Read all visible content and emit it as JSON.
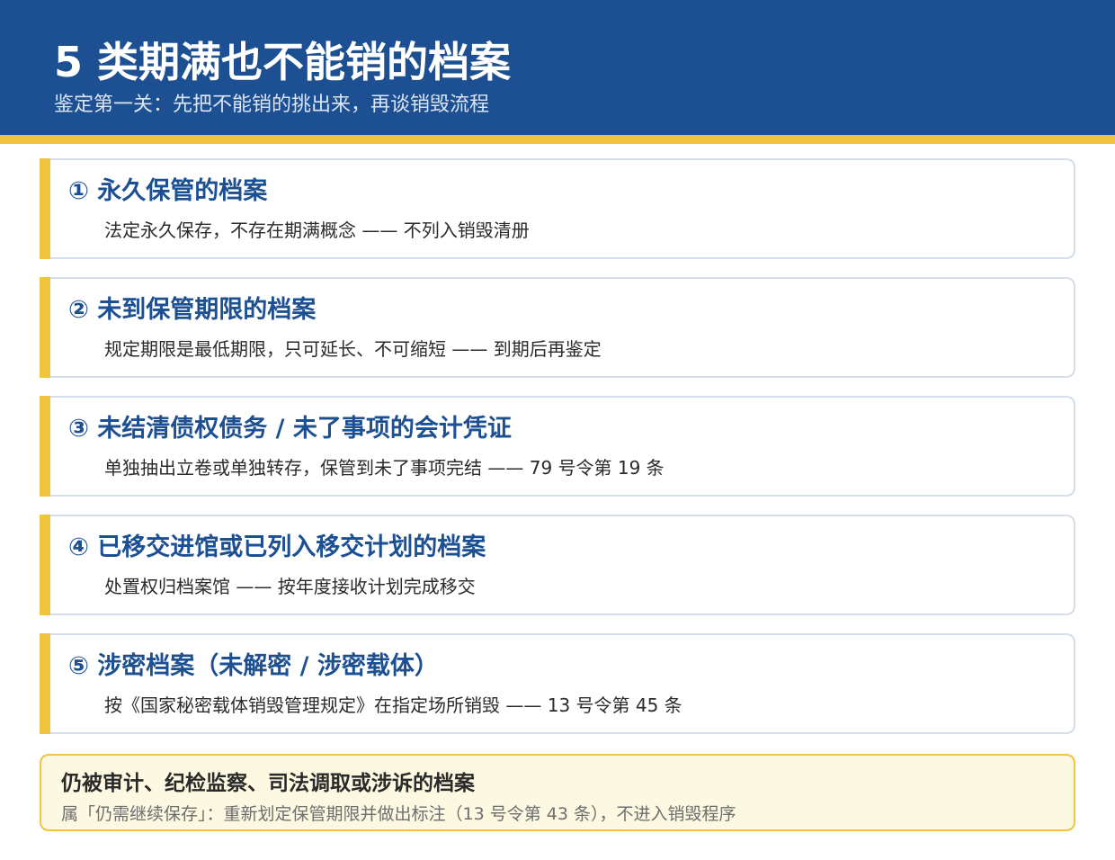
{
  "header": {
    "title": "5 类期满也不能销的档案",
    "subtitle": "鉴定第一关：先把不能销的挑出来，再谈销毁流程"
  },
  "items": [
    {
      "title": "① 永久保管的档案",
      "desc": "法定永久保存，不存在期满概念 —— 不列入销毁清册"
    },
    {
      "title": "② 未到保管期限的档案",
      "desc": "规定期限是最低期限，只可延长、不可缩短 —— 到期后再鉴定"
    },
    {
      "title": "③ 未结清债权债务 / 未了事项的会计凭证",
      "desc": "单独抽出立卷或单独转存，保管到未了事项完结 —— 79 号令第 19 条"
    },
    {
      "title": "④ 已移交进馆或已列入移交计划的档案",
      "desc": "处置权归档案馆 —— 按年度接收计划完成移交"
    },
    {
      "title": "⑤ 涉密档案（未解密 / 涉密载体）",
      "desc": "按《国家秘密载体销毁管理规定》在指定场所销毁 —— 13 号令第 45 条"
    }
  ],
  "note": {
    "title": "仍被审计、纪检监察、司法调取或涉诉的档案",
    "desc": "属「仍需继续保存」：重新划定保管期限并做出标注（13 号令第 43 条），不进入销毁程序"
  },
  "colors": {
    "header_bg": "#1d5092",
    "accent": "#f0c43e",
    "title_blue": "#1d5092",
    "note_bg": "#fdf8e1"
  }
}
